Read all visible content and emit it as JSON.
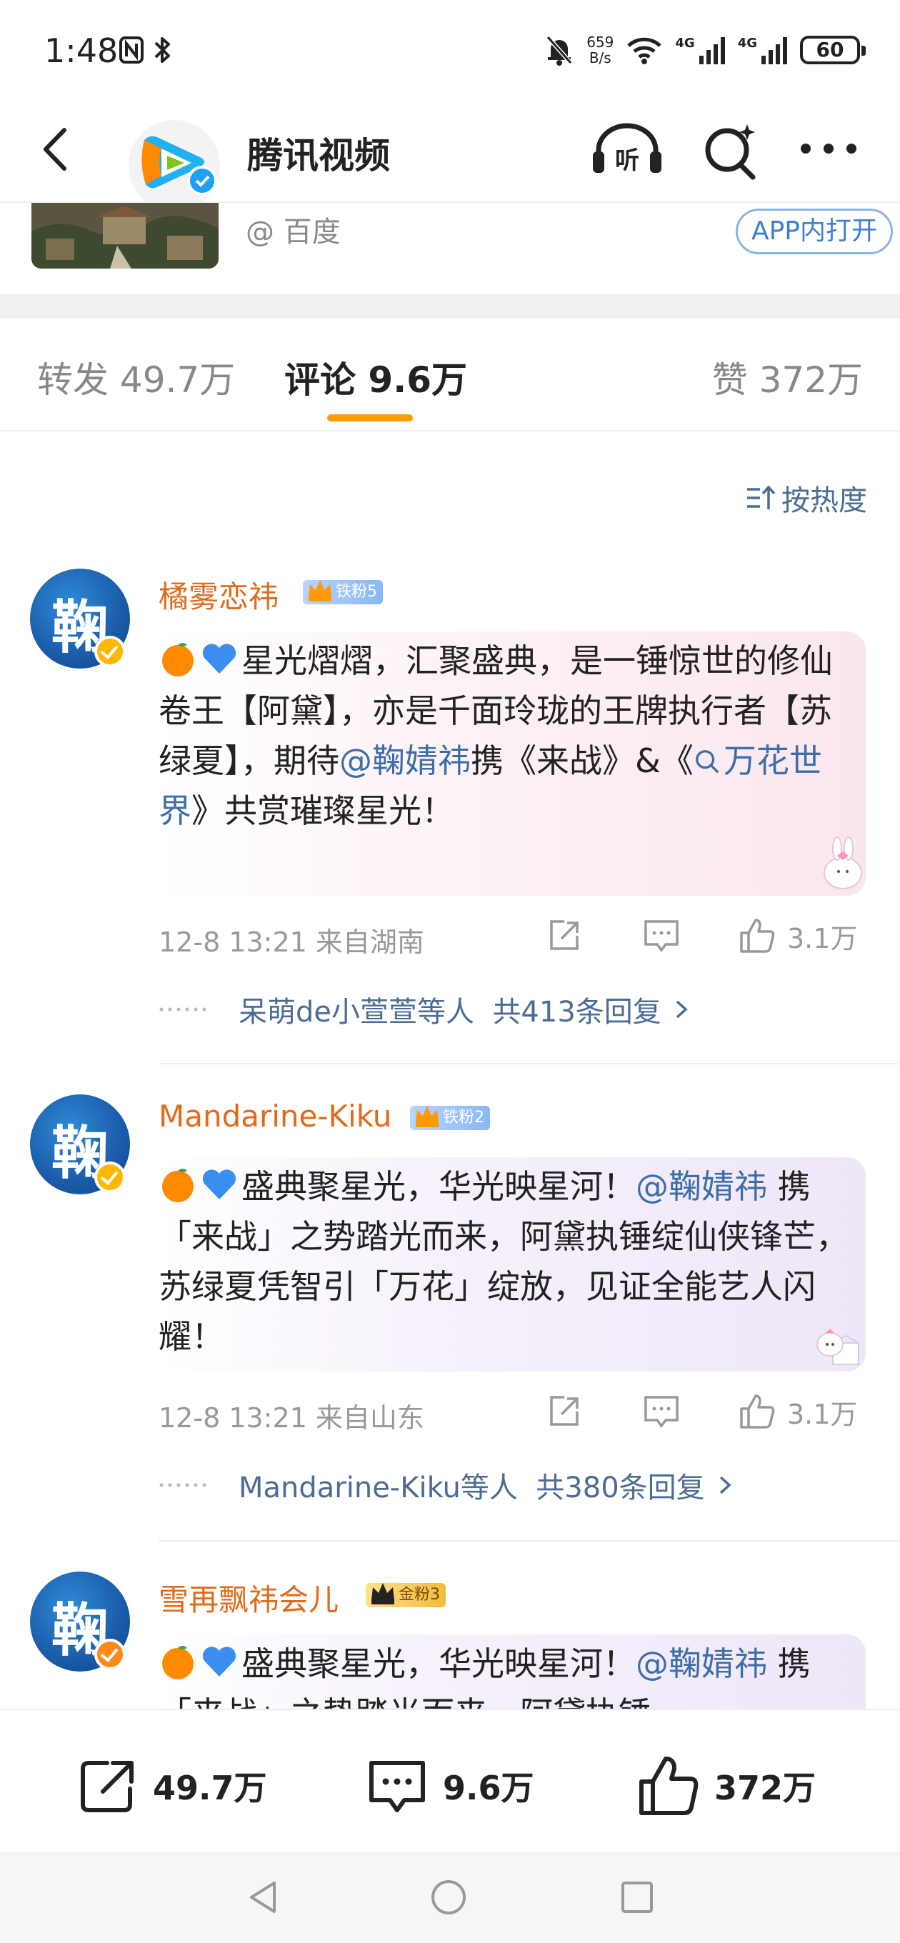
{
  "status_bar": {
    "time": "1:48",
    "net_speed_value": "659",
    "net_speed_unit": "B/s",
    "sim1_label": "4G",
    "sim2_label": "4G",
    "battery": "60",
    "icons": [
      "nfc-icon",
      "bluetooth-icon",
      "mute-bell-icon",
      "wifi-icon",
      "signal-icon"
    ]
  },
  "header": {
    "title": "腾讯视频",
    "listen_label": "听",
    "icons": [
      "back-icon",
      "listen-icon",
      "search-icon",
      "more-icon"
    ]
  },
  "card": {
    "source": "@ 百度",
    "open_app": "APP内打开"
  },
  "tabs": {
    "repost": "转发 49.7万",
    "comment": "评论 9.6万",
    "like": "赞 372万"
  },
  "sort": {
    "label": "按热度"
  },
  "comments": [
    {
      "avatar_char": "鞠",
      "name": "橘雾恋祎",
      "badge": "铁粉5",
      "text_1": "星光熠熠，汇聚盛典，是一锤惊世的修仙卷王【阿黛】，亦是千面玲珑的王牌执行者【苏绿夏】，期待",
      "mention": "@鞠婧祎",
      "text_2": "携《来战》&《",
      "topic": "万花世界",
      "text_3": "》共赏璀璨星光！",
      "time_location": "12-8 13:21  来自湖南",
      "likes": "3.1万",
      "replies_by": "呆萌de小萱萱等人",
      "replies_count": "共413条回复"
    },
    {
      "avatar_char": "鞠",
      "name": "Mandarine-Kiku",
      "badge": "铁粉2",
      "text_1": "盛典聚星光，华光映星河！",
      "mention": "@鞠婧祎",
      "text_2": " 携「来战」之势踏光而来，阿黛执锤绽仙侠锋芒，苏绿夏凭智引「万花」绽放，见证全能艺人闪耀！",
      "time_location": "12-8 13:21  来自山东",
      "likes": "3.1万",
      "replies_by": "Mandarine-Kiku等人",
      "replies_count": "共380条回复"
    },
    {
      "avatar_char": "鞠",
      "name": "雪再飘祎会儿",
      "badge": "金粉3",
      "text_1": "盛典聚星光，华光映星河！",
      "mention": "@鞠婧祎",
      "text_2": " 携「来战」之势踏光而来，阿黛执锤"
    }
  ],
  "bottom_bar": {
    "repost": "49.7万",
    "comment": "9.6万",
    "like": "372万"
  },
  "colors": {
    "accent_orange": "#ff9a00",
    "name_orange": "#e06b1a",
    "link_blue": "#3d6ea8",
    "muted_gray": "#999999"
  }
}
